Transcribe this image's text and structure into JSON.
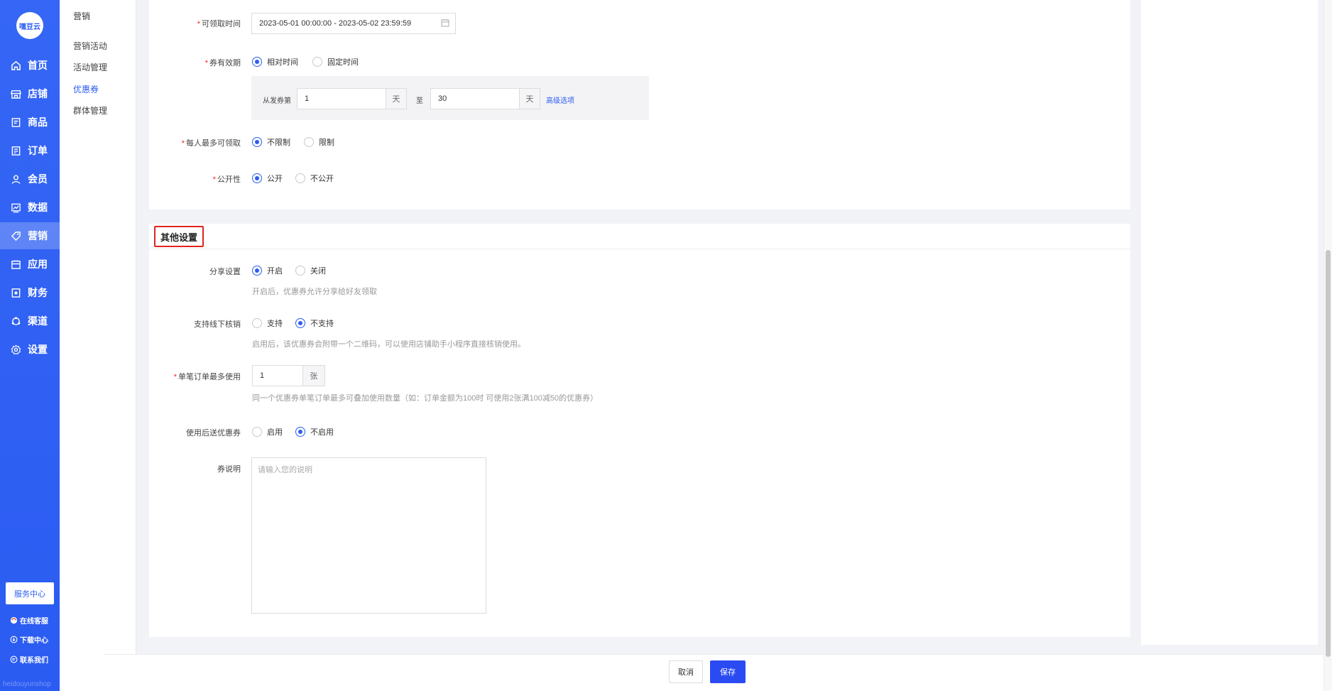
{
  "nav": {
    "logo": "嘿豆云",
    "items": [
      {
        "label": "首页",
        "icon": "home-icon"
      },
      {
        "label": "店铺",
        "icon": "store-icon"
      },
      {
        "label": "商品",
        "icon": "goods-icon"
      },
      {
        "label": "订单",
        "icon": "order-icon"
      },
      {
        "label": "会员",
        "icon": "user-icon"
      },
      {
        "label": "数据",
        "icon": "chart-icon"
      },
      {
        "label": "营销",
        "icon": "tag-icon"
      },
      {
        "label": "应用",
        "icon": "app-icon"
      },
      {
        "label": "财务",
        "icon": "finance-icon"
      },
      {
        "label": "渠道",
        "icon": "channel-icon"
      },
      {
        "label": "设置",
        "icon": "gear-icon"
      }
    ],
    "active": "营销",
    "service_center": "服务中心",
    "links": [
      "在线客服",
      "下载中心",
      "联系我们"
    ],
    "footer": "heidouyunshop"
  },
  "subnav": {
    "title": "营销",
    "items": [
      "营销活动",
      "活动管理",
      "优惠券",
      "群体管理"
    ],
    "active": "优惠券"
  },
  "form": {
    "claim_time": {
      "label": "可领取时间",
      "value": "2023-05-01 00:00:00 - 2023-05-02 23:59:59"
    },
    "validity": {
      "label": "券有效期",
      "options": [
        "相对时间",
        "固定时间"
      ],
      "selected": "相对时间",
      "from_label": "从发券第",
      "from_value": "1",
      "unit_day": "天",
      "to_label": "至",
      "to_value": "30",
      "advanced": "高级选项"
    },
    "per_person": {
      "label": "每人最多可领取",
      "options": [
        "不限制",
        "限制"
      ],
      "selected": "不限制"
    },
    "publicity": {
      "label": "公开性",
      "options": [
        "公开",
        "不公开"
      ],
      "selected": "公开"
    }
  },
  "other": {
    "title": "其他设置",
    "share": {
      "label": "分享设置",
      "options": [
        "开启",
        "关闭"
      ],
      "selected": "开启",
      "hint": "开启后，优惠券允许分享给好友领取"
    },
    "offline": {
      "label": "支持线下核销",
      "options": [
        "支持",
        "不支持"
      ],
      "selected": "不支持",
      "hint": "启用后，该优惠券会附带一个二维码，可以使用店铺助手小程序直接核销使用。"
    },
    "max_per_order": {
      "label": "单笔订单最多使用",
      "value": "1",
      "unit": "张",
      "hint": "同一个优惠券单笔订单最多可叠加使用数量（如：订单金额为100时 可使用2张满100减50的优惠券）"
    },
    "send_after_use": {
      "label": "使用后送优惠券",
      "options": [
        "启用",
        "不启用"
      ],
      "selected": "不启用"
    },
    "description": {
      "label": "券说明",
      "placeholder": "请输入您的说明"
    }
  },
  "actions": {
    "cancel": "取消",
    "save": "保存"
  },
  "colors": {
    "primary": "#2b5cf2",
    "required": "#f5222d",
    "highlight_border": "#e0241f"
  }
}
